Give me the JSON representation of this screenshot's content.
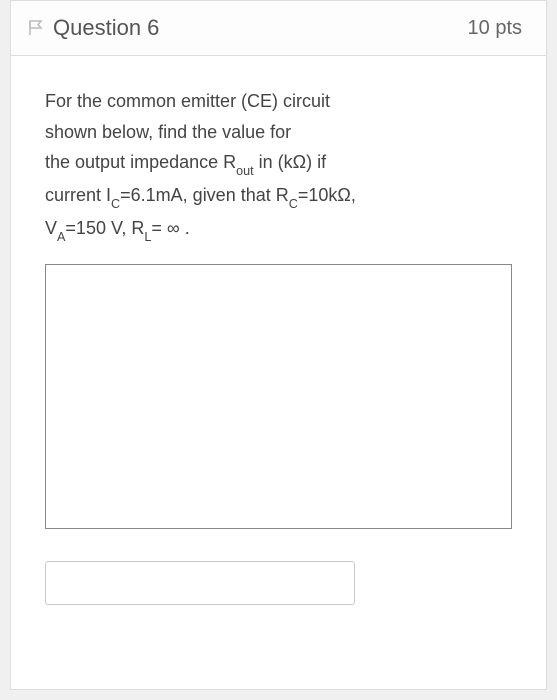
{
  "header": {
    "title": "Question 6",
    "points": "10 pts"
  },
  "body": {
    "line1_part1": "For the common emitter (CE) circuit",
    "line2": "shown below, find the value for",
    "line3_part1": "the ",
    "line3_bold": "output impedance",
    "line3_part2": " R",
    "line3_sub": "out",
    "line3_part3": " in (kΩ) if",
    "line4_part1": "current I",
    "line4_sub1": "C",
    "line4_part2": "=6.1mA, given that R",
    "line4_sub2": "C",
    "line4_part3": "=10kΩ,",
    "line5_part1": "V",
    "line5_sub1": "A",
    "line5_part2": "=150 V, R",
    "line5_sub2": "L",
    "line5_part3": "= ∞ ."
  },
  "answer": {
    "value": "",
    "placeholder": ""
  }
}
